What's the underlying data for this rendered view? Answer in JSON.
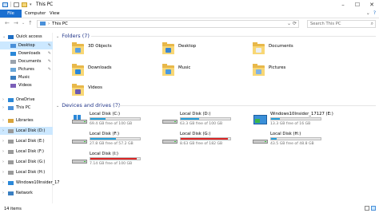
{
  "window": {
    "title": "This PC"
  },
  "ribbon": {
    "tabs": [
      "File",
      "Computer",
      "View"
    ]
  },
  "address": {
    "path": "This PC",
    "search_placeholder": "Search This PC"
  },
  "nav": [
    {
      "label": "Quick access",
      "icon": "star-icon",
      "indent": 0,
      "chev": "v",
      "color": "#1f6fc5"
    },
    {
      "label": "Desktop",
      "icon": "desktop-folder-icon",
      "indent": 1,
      "pin": true,
      "selected": true,
      "color": "#4a90d9"
    },
    {
      "label": "Downloads",
      "icon": "downloads-icon",
      "indent": 1,
      "pin": true,
      "color": "#2b88d8"
    },
    {
      "label": "Documents",
      "icon": "documents-icon",
      "indent": 1,
      "pin": true,
      "color": "#9aa3ad"
    },
    {
      "label": "Pictures",
      "icon": "pictures-icon",
      "indent": 1,
      "pin": true,
      "color": "#6aa6d8"
    },
    {
      "label": "Music",
      "icon": "music-icon",
      "indent": 1,
      "color": "#3a7fc1"
    },
    {
      "label": "Videos",
      "icon": "videos-icon",
      "indent": 1,
      "color": "#7b5fb8"
    },
    {
      "label": "OneDrive",
      "icon": "onedrive-icon",
      "indent": 0,
      "chev": ">",
      "color": "#2b88d8"
    },
    {
      "label": "This PC",
      "icon": "this-pc-icon",
      "indent": 0,
      "chev": ">",
      "color": "#4a90d9"
    },
    {
      "label": "Libraries",
      "icon": "libraries-icon",
      "indent": 0,
      "chev": ">",
      "color": "#d9a53c"
    },
    {
      "label": "Local Disk (D:)",
      "icon": "drive-icon",
      "indent": 0,
      "chev": ">",
      "selected": true,
      "color": "#9a9a9a"
    },
    {
      "label": "Local Disk (E:)",
      "icon": "drive-icon",
      "indent": 0,
      "chev": ">",
      "color": "#9a9a9a"
    },
    {
      "label": "Local Disk (F:)",
      "icon": "drive-icon",
      "indent": 0,
      "chev": ">",
      "color": "#9a9a9a"
    },
    {
      "label": "Local Disk (G:)",
      "icon": "drive-icon",
      "indent": 0,
      "chev": ">",
      "color": "#9a9a9a"
    },
    {
      "label": "Local Disk (H:)",
      "icon": "drive-icon",
      "indent": 0,
      "chev": ">",
      "color": "#9a9a9a"
    },
    {
      "label": "Windows10Insider_17",
      "icon": "drive-icon",
      "indent": 0,
      "chev": ">",
      "color": "#2b88d8"
    },
    {
      "label": "Network",
      "icon": "network-icon",
      "indent": 0,
      "chev": ">",
      "color": "#3a7fc1"
    }
  ],
  "folders_group": {
    "title": "Folders (7)",
    "items": [
      {
        "label": "3D Objects",
        "icon": "3d-objects-folder-icon",
        "badge": "#5aa0e0"
      },
      {
        "label": "Desktop",
        "icon": "desktop-folder-icon",
        "badge": "#3a86d1"
      },
      {
        "label": "Documents",
        "icon": "documents-folder-icon",
        "badge": "#e9eef4"
      },
      {
        "label": "Downloads",
        "icon": "downloads-folder-icon",
        "badge": "#2b88d8"
      },
      {
        "label": "Music",
        "icon": "music-folder-icon",
        "badge": "#4a9be0"
      },
      {
        "label": "Pictures",
        "icon": "pictures-folder-icon",
        "badge": "#7fb3e4"
      },
      {
        "label": "Videos",
        "icon": "videos-folder-icon",
        "badge": "#6b5bb0"
      }
    ]
  },
  "drives_group": {
    "title": "Devices and drives (7)",
    "items": [
      {
        "label": "Local Disk (C:)",
        "free": "69.4 GB free of 100 GB",
        "used_fraction": 0.31,
        "bar_color": "#26a0da",
        "system": true
      },
      {
        "label": "Local Disk (D:)",
        "free": "63.3 GB free of 100 GB",
        "used_fraction": 0.37,
        "bar_color": "#26a0da"
      },
      {
        "label": "Windows10Insider_17127 (E:)",
        "free": "13.3 GB free of 16 GB",
        "used_fraction": 0.17,
        "bar_color": "#26a0da",
        "install": true
      },
      {
        "label": "Local Disk (F:)",
        "free": "27.8 GB free of 57.2 GB",
        "used_fraction": 0.51,
        "bar_color": "#26a0da"
      },
      {
        "label": "Local Disk (G:)",
        "free": "8.63 GB free of 182 GB",
        "used_fraction": 0.95,
        "bar_color": "#da2626"
      },
      {
        "label": "Local Disk (H:)",
        "free": "43.5 GB free of 48.8 GB",
        "used_fraction": 0.11,
        "bar_color": "#26a0da"
      },
      {
        "label": "Local Disk (I:)",
        "free": "7.14 GB free of 100 GB",
        "used_fraction": 0.93,
        "bar_color": "#da2626"
      }
    ]
  },
  "status": {
    "count": "14 items"
  }
}
